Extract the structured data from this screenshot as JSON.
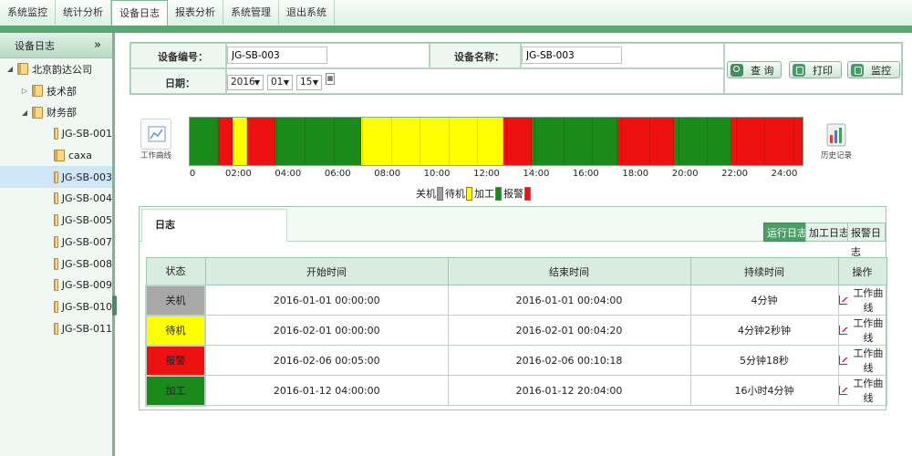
{
  "nav": {
    "items": [
      {
        "label": "系统监控",
        "active": false
      },
      {
        "label": "统计分析",
        "active": false
      },
      {
        "label": "设备日志",
        "active": true
      },
      {
        "label": "报表分析",
        "active": false
      },
      {
        "label": "系统管理",
        "active": false
      },
      {
        "label": "退出系统",
        "active": false
      }
    ]
  },
  "sidebar": {
    "title": "设备日志",
    "collapse_glyph": "»",
    "tree": {
      "company": "北京韵达公司",
      "departments": [
        {
          "name": "技术部",
          "expanded": false
        },
        {
          "name": "财务部",
          "expanded": true
        }
      ],
      "devices": [
        "JG-SB-001",
        "caxa",
        "JG-SB-003",
        "JG-SB-004",
        "JG-SB-005",
        "JG-SB-007",
        "JG-SB-008",
        "JG-SB-009",
        "JG-SB-010",
        "JG-SB-011"
      ],
      "selected_device": "JG-SB-003"
    }
  },
  "query": {
    "device_code_label": "设备编号：",
    "device_code_value": "JG-SB-003",
    "device_name_label": "设备名称：",
    "device_name_value": "JG-SB-003",
    "date_label": "日期：",
    "year": "2016",
    "month": "01",
    "day": "15",
    "search_label": "查 询",
    "print_label": "打印",
    "monitor_label": "监控"
  },
  "timeline": {
    "work_curve_label": "工作曲线",
    "history_label": "历史记录",
    "ticks": [
      "0",
      "02:00",
      "04:00",
      "06:00",
      "08:00",
      "10:00",
      "12:00",
      "14:00",
      "16:00",
      "18:00",
      "20:00",
      "22:00",
      "24:00"
    ],
    "colors": {
      "off": "#9e9e9e",
      "standby": "#ffff00",
      "processing": "#1a8a1a",
      "alarm": "#ee1111"
    },
    "segments": [
      {
        "state": "processing",
        "start": 0,
        "end": 1.0
      },
      {
        "state": "alarm",
        "start": 1.0,
        "end": 1.5
      },
      {
        "state": "standby",
        "start": 1.5,
        "end": 2.0
      },
      {
        "state": "alarm",
        "start": 2.0,
        "end": 3.0
      },
      {
        "state": "processing",
        "start": 3.0,
        "end": 6.0
      },
      {
        "state": "standby",
        "start": 6.0,
        "end": 11.0
      },
      {
        "state": "alarm",
        "start": 11.0,
        "end": 12.0
      },
      {
        "state": "processing",
        "start": 12.0,
        "end": 15.0
      },
      {
        "state": "alarm",
        "start": 15.0,
        "end": 17.0
      },
      {
        "state": "processing",
        "start": 17.0,
        "end": 19.0
      },
      {
        "state": "alarm",
        "start": 19.0,
        "end": 21.5
      }
    ],
    "legend": [
      {
        "label": "关机",
        "state": "off"
      },
      {
        "label": "待机",
        "state": "standby"
      },
      {
        "label": "加工",
        "state": "processing"
      },
      {
        "label": "报警",
        "state": "alarm"
      }
    ]
  },
  "log": {
    "title": "日志",
    "tabs": [
      {
        "label": "运行日志",
        "active": true
      },
      {
        "label": "加工日志",
        "active": false
      },
      {
        "label": "报警日志",
        "active": false
      }
    ],
    "columns": [
      "状态",
      "开始时间",
      "结束时间",
      "持续时间",
      "操作"
    ],
    "rows": [
      {
        "state": "关机",
        "state_color": "#a8a8a8",
        "start": "2016-01-01 00:00:00",
        "end": "2016-01-01 00:04:00",
        "duration": "4分钟",
        "action": "工作曲线"
      },
      {
        "state": "待机",
        "state_color": "#ffff00",
        "start": "2016-02-01 00:00:00",
        "end": "2016-02-01 00:04:20",
        "duration": "4分钟2秒钟",
        "action": "工作曲线"
      },
      {
        "state": "报警",
        "state_color": "#ee1111",
        "start": "2016-02-06 00:05:00",
        "end": "2016-02-06 00:10:18",
        "duration": "5分钟18秒",
        "action": "工作曲线"
      },
      {
        "state": "加工",
        "state_color": "#1a8a1a",
        "start": "2016-01-12 04:00:00",
        "end": "2016-01-12 20:04:00",
        "duration": "16小时4分钟",
        "action": "工作曲线"
      }
    ]
  }
}
